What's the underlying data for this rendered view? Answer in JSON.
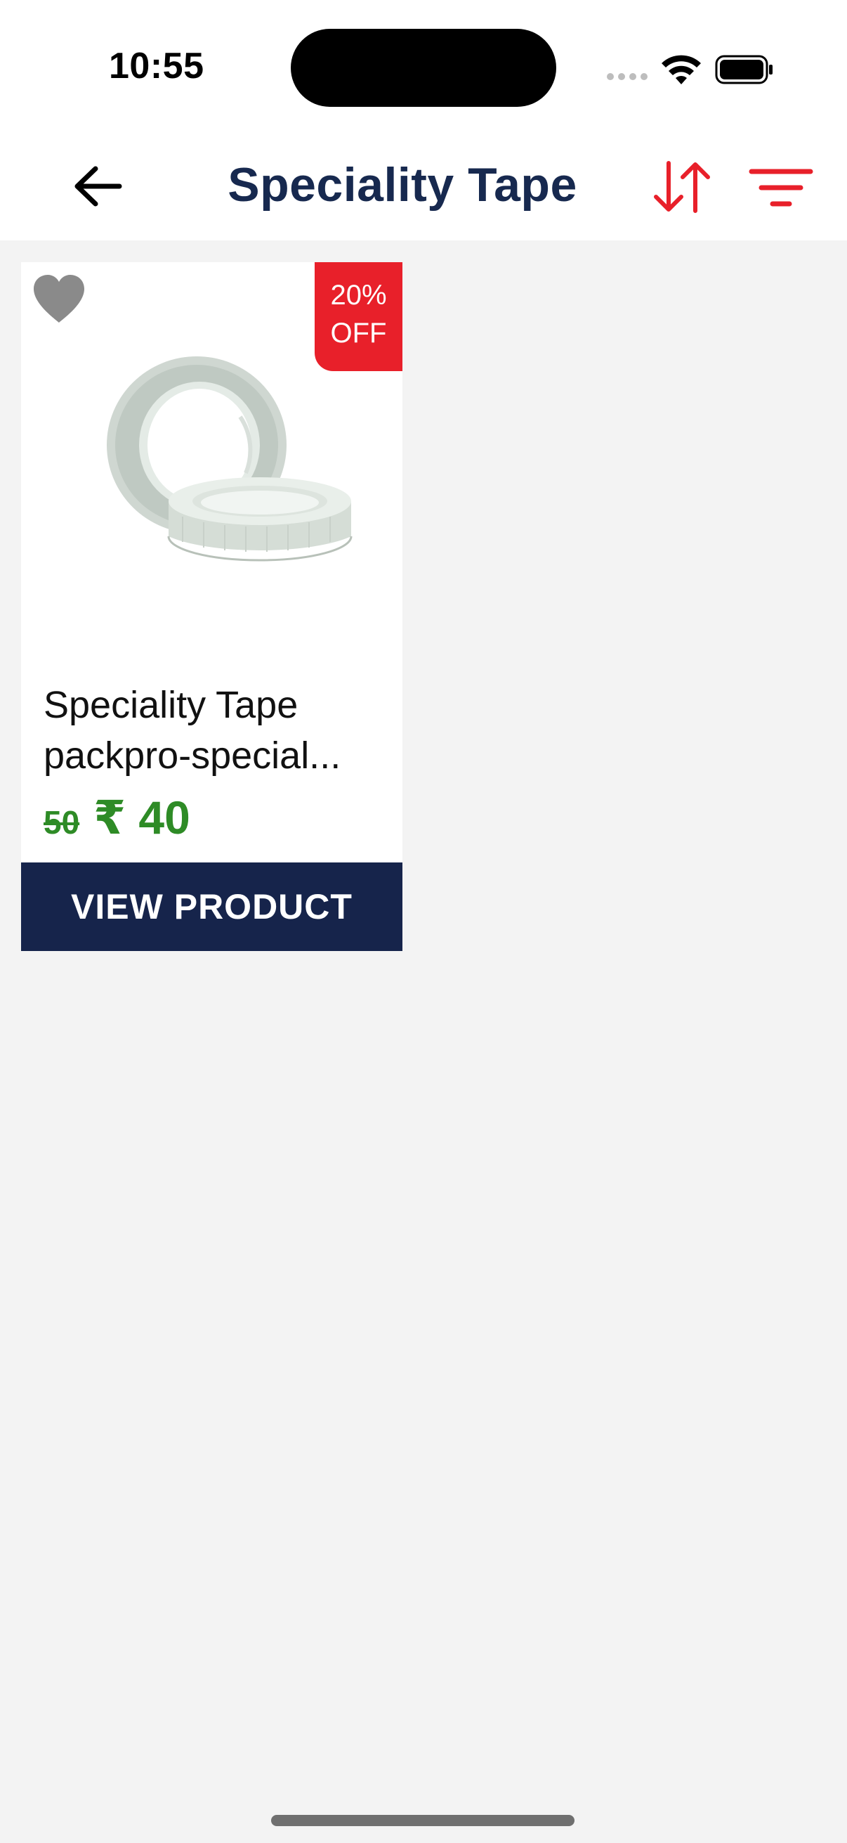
{
  "status_bar": {
    "time": "10:55",
    "wifi_icon": "wifi-icon",
    "battery_icon": "battery-icon",
    "signal_icon": "cellular-dots-icon"
  },
  "header": {
    "title": "Speciality Tape",
    "back_icon": "arrow-left-icon",
    "sort_icon": "sort-arrows-icon",
    "filter_icon": "filter-lines-icon",
    "accent_color": "#e8202a",
    "title_color": "#17294f"
  },
  "products": [
    {
      "name_line1": "Speciality Tape",
      "name_line2": "packpro-special...",
      "old_price": "50",
      "new_price": "₹ 40",
      "discount_line1": "20%",
      "discount_line2": "OFF",
      "wishlist_icon": "heart-icon",
      "image": "tape-rolls-image",
      "button_label": "VIEW PRODUCT",
      "price_color": "#2e8b26",
      "button_color": "#16244b"
    }
  ]
}
